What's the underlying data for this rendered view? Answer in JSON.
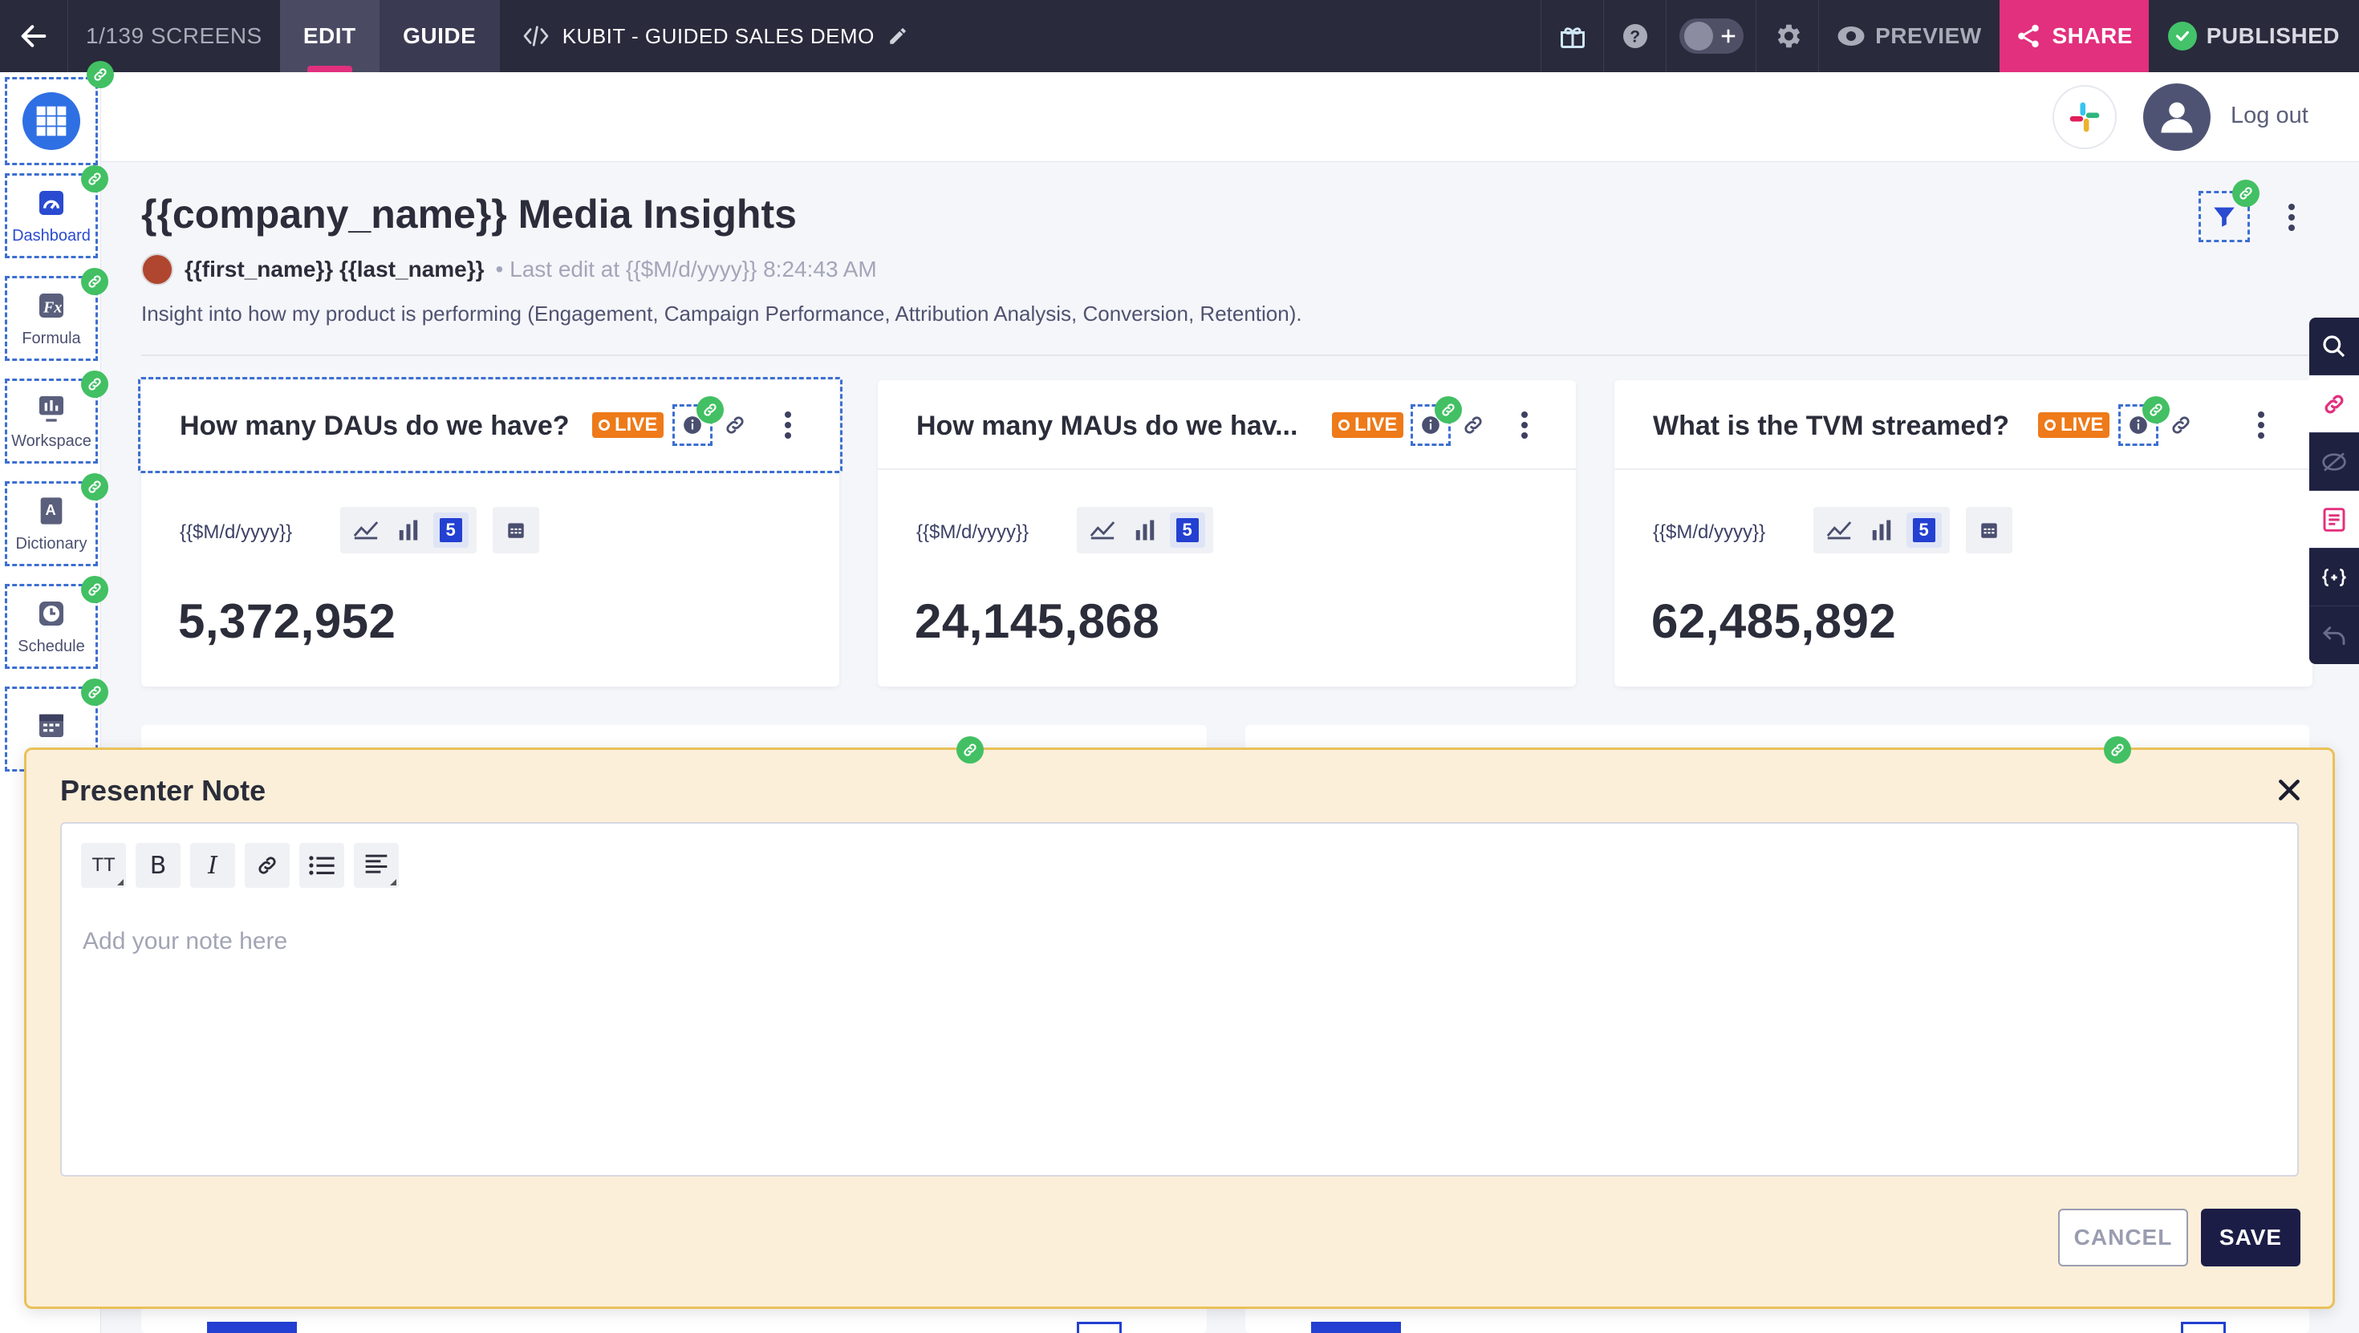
{
  "topbar": {
    "screens": "1/139 SCREENS",
    "edit": "EDIT",
    "guide": "GUIDE",
    "title": "KUBIT - GUIDED SALES DEMO",
    "preview": "PREVIEW",
    "share": "SHARE",
    "published": "PUBLISHED",
    "accent": "#e2307e"
  },
  "header": {
    "logout": "Log out"
  },
  "sidebar": {
    "items": [
      {
        "label": "Dashboard",
        "icon": "dashboard-icon"
      },
      {
        "label": "Formula",
        "icon": "formula-icon"
      },
      {
        "label": "Workspace",
        "icon": "workspace-icon"
      },
      {
        "label": "Dictionary",
        "icon": "dictionary-icon"
      },
      {
        "label": "Schedule",
        "icon": "clock-icon"
      },
      {
        "label": "",
        "icon": "calendar-icon"
      }
    ]
  },
  "page": {
    "title": "{{company_name}} Media Insights",
    "author": "{{first_name}} {{last_name}}",
    "last_edit": "Last edit at {{$M/d/yyyy}} 8:24:43 AM",
    "description": "Insight into how my product is performing (Engagement, Campaign Performance, Attribution Analysis, Conversion, Retention)."
  },
  "cards": [
    {
      "title": "How many DAUs do we have?",
      "live": "LIVE",
      "date": "{{$M/d/yyyy}}",
      "badge": "5",
      "value": "5,372,952"
    },
    {
      "title": "How many MAUs do we hav...",
      "live": "LIVE",
      "date": "{{$M/d/yyyy}}",
      "badge": "5",
      "value": "24,145,868"
    },
    {
      "title": "What is the TVM streamed?",
      "live": "LIVE",
      "date": "{{$M/d/yyyy}}",
      "badge": "5",
      "value": "62,485,892"
    }
  ],
  "note": {
    "title": "Presenter Note",
    "text_size_label": "TT",
    "bold_label": "B",
    "italic_label": "I",
    "placeholder": "Add your note here",
    "cancel": "CANCEL",
    "save": "SAVE"
  }
}
